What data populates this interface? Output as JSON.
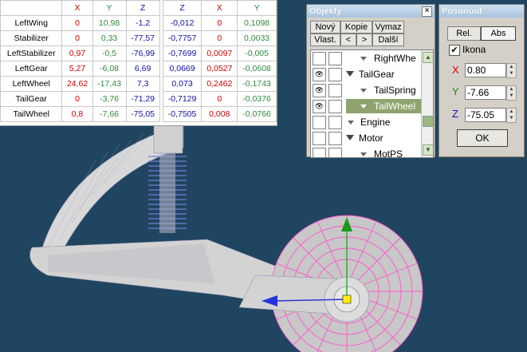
{
  "table": {
    "headers_left": [
      "",
      "X",
      "Y",
      "Z"
    ],
    "headers_right": [
      "Z",
      "X",
      "Y"
    ],
    "rows": [
      {
        "name": "LeftWing",
        "x": "0",
        "y": "10,98",
        "z": "-1,2",
        "z2": "-0,012",
        "x2": "0",
        "y2": "0,1098"
      },
      {
        "name": "Stabilizer",
        "x": "0",
        "y": "0,33",
        "z": "-77,57",
        "z2": "-0,7757",
        "x2": "0",
        "y2": "0,0033"
      },
      {
        "name": "LeftStabilizer",
        "x": "0,97",
        "y": "-0,5",
        "z": "-76,99",
        "z2": "-0,7699",
        "x2": "0,0097",
        "y2": "-0,005"
      },
      {
        "name": "LeftGear",
        "x": "5,27",
        "y": "-6,08",
        "z": "6,69",
        "z2": "0,0669",
        "x2": "0,0527",
        "y2": "-0,0608"
      },
      {
        "name": "LeftWheel",
        "x": "24,62",
        "y": "-17,43",
        "z": "7,3",
        "z2": "0,073",
        "x2": "0,2462",
        "y2": "-0,1743"
      },
      {
        "name": "TailGear",
        "x": "0",
        "y": "-3,76",
        "z": "-71,29",
        "z2": "-0,7129",
        "x2": "0",
        "y2": "-0,0376"
      },
      {
        "name": "TailWheel",
        "x": "0,8",
        "y": "-7,66",
        "z": "-75,05",
        "z2": "-0,7505",
        "x2": "0,008",
        "y2": "-0,0766"
      }
    ]
  },
  "objekty": {
    "title": "Objekty",
    "buttons": {
      "novy": "Nový",
      "kopie": "Kopie",
      "vymaz": "Vymaz",
      "vlast": "Vlast.",
      "prev": "<",
      "next": ">",
      "dalsi": "Další"
    },
    "items": [
      {
        "label": "RightWhe",
        "level": 2,
        "expanded": false,
        "visible_icon": false
      },
      {
        "label": "TailGear",
        "level": 1,
        "expanded": true,
        "visible_icon": true
      },
      {
        "label": "TailSpring",
        "level": 2,
        "expanded": false,
        "visible_icon": true
      },
      {
        "label": "TailWheel",
        "level": 2,
        "expanded": false,
        "visible_icon": true,
        "selected": true
      },
      {
        "label": "Engine",
        "level": 1,
        "expanded": false,
        "visible_icon": false
      },
      {
        "label": "Motor",
        "level": 1,
        "expanded": true,
        "visible_icon": false
      },
      {
        "label": "MotPS",
        "level": 2,
        "expanded": false,
        "visible_icon": false
      }
    ]
  },
  "posunout": {
    "title": "Posunout",
    "rel": "Rel.",
    "abs": "Abs",
    "ikona": "Ikona",
    "x_label": "X",
    "x_value": "0.80",
    "y_label": "Y",
    "y_value": "-7.66",
    "z_label": "Z",
    "z_value": "-75.05",
    "ok": "OK"
  }
}
